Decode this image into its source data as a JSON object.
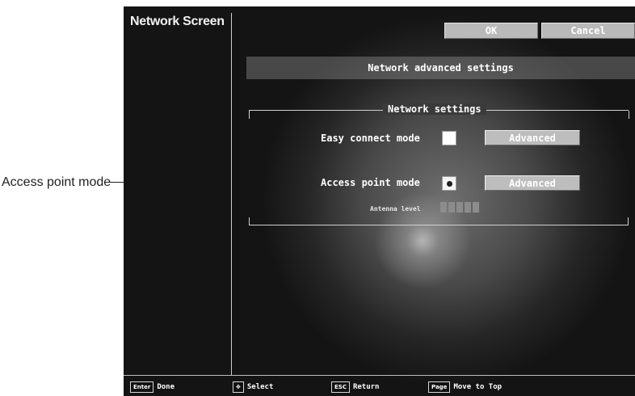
{
  "callout": {
    "text": "Access point mode"
  },
  "screen": {
    "title": "Network Screen",
    "buttons": {
      "ok": "OK",
      "cancel": "Cancel"
    },
    "banner": "Network advanced settings",
    "group_title": "Network settings",
    "easy_connect": {
      "label": "Easy connect mode",
      "checked": false,
      "advanced": "Advanced"
    },
    "access_point": {
      "label": "Access point mode",
      "checked": true,
      "advanced": "Advanced"
    },
    "antenna": {
      "label": "Antenna level",
      "bars": 5
    },
    "footer": [
      {
        "key": "Enter",
        "text": "Done"
      },
      {
        "key": "✥",
        "text": "Select"
      },
      {
        "key": "ESC",
        "text": "Return"
      },
      {
        "key": "Page",
        "text": "Move to Top"
      }
    ]
  }
}
